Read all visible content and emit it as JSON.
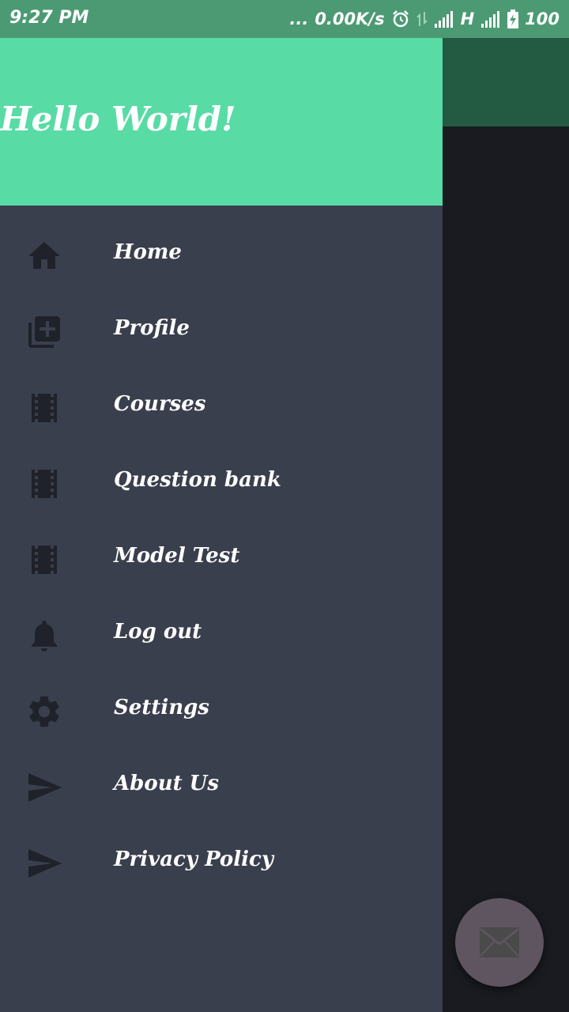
{
  "status_bar": {
    "time": "9:27 PM",
    "dots": "...",
    "speed": "0.00K/s",
    "network_type": "H",
    "battery": "100"
  },
  "drawer": {
    "header_title": "Hello World!",
    "menu": [
      {
        "label": "Home",
        "icon": "home-icon"
      },
      {
        "label": "Profile",
        "icon": "add-to-photos-icon"
      },
      {
        "label": "Courses",
        "icon": "film-icon"
      },
      {
        "label": "Question bank",
        "icon": "film-icon"
      },
      {
        "label": "Model Test",
        "icon": "film-icon"
      },
      {
        "label": "Log out",
        "icon": "bell-icon"
      },
      {
        "label": "Settings",
        "icon": "gear-icon"
      },
      {
        "label": "About Us",
        "icon": "send-icon"
      },
      {
        "label": "Privacy Policy",
        "icon": "send-icon"
      }
    ]
  },
  "fab": {
    "icon": "mail-icon"
  },
  "colors": {
    "status_bar": "#4c9a74",
    "drawer_header": "#58dba5",
    "drawer_body": "#3a3f4d",
    "icon": "#1f222b",
    "scrim_toolbar": "#235a42",
    "scrim_content": "#191b20",
    "fab": "#5f5560"
  }
}
